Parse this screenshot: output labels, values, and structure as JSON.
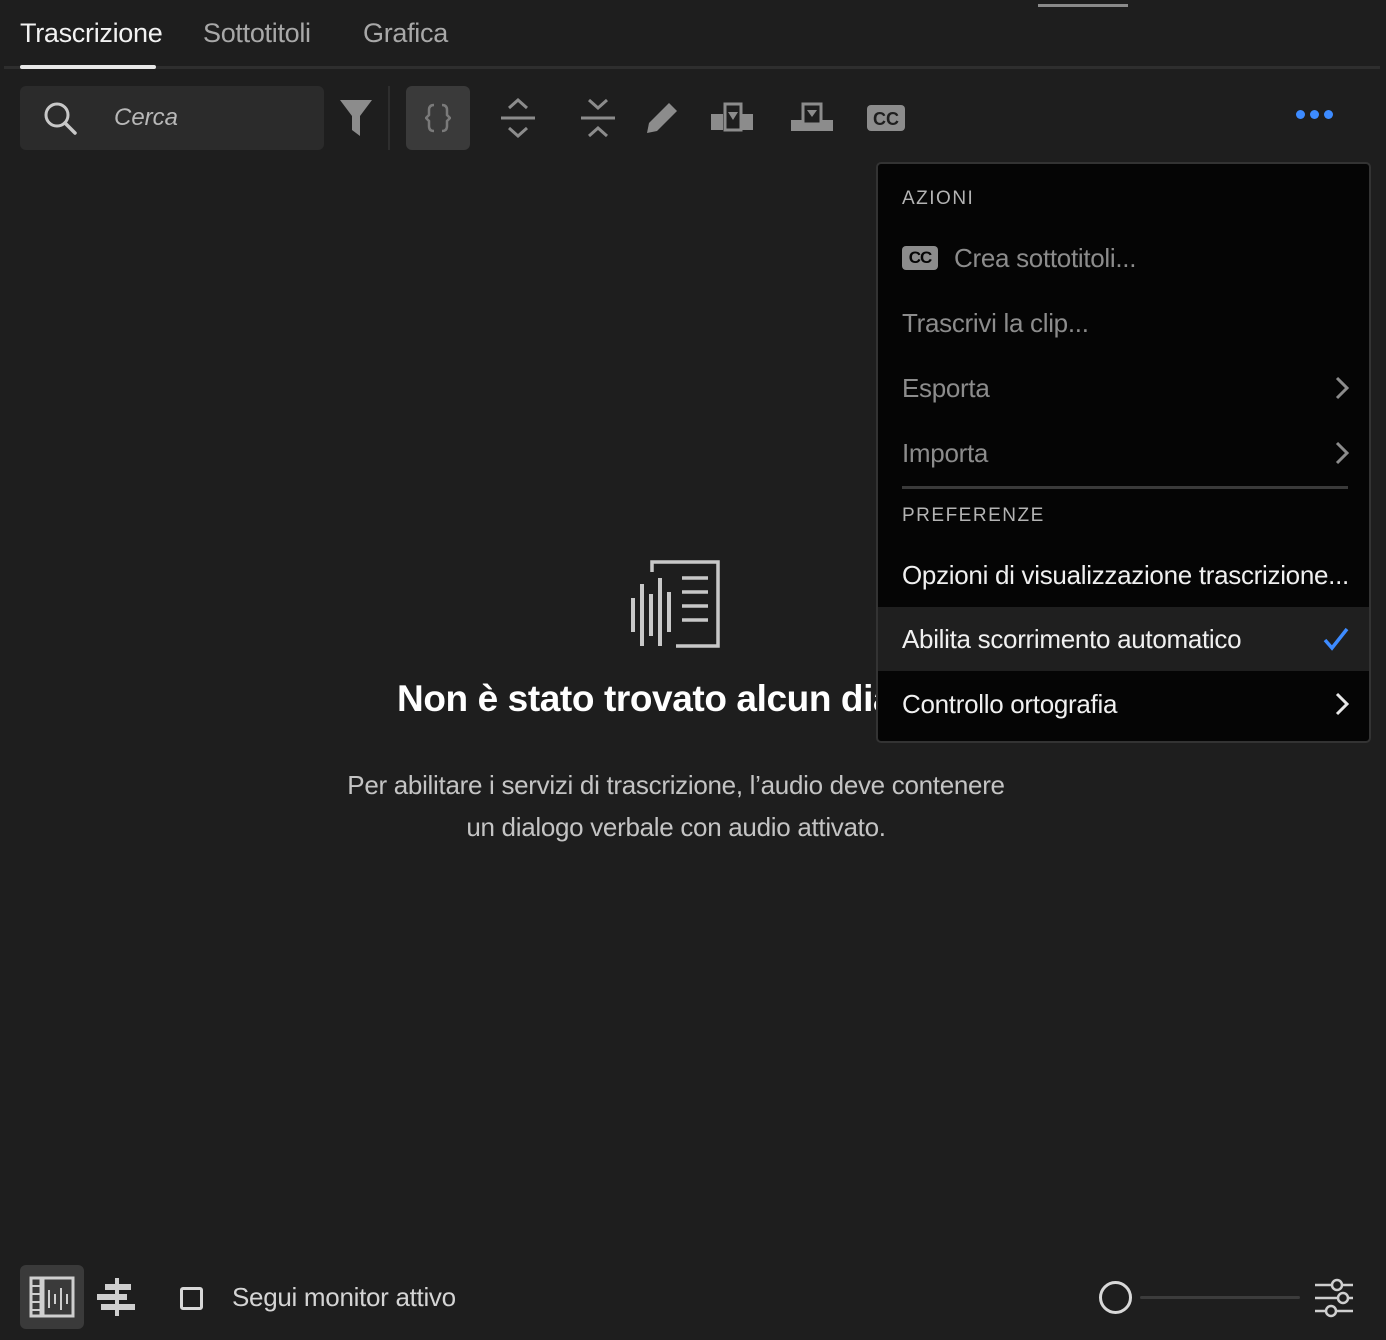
{
  "tabs": [
    {
      "label": "Trascrizione",
      "active": true
    },
    {
      "label": "Sottotitoli",
      "active": false
    },
    {
      "label": "Grafica",
      "active": false
    }
  ],
  "toolbar": {
    "search_placeholder": "Cerca",
    "icons": [
      "search-icon",
      "filter-icon",
      "merge-segments-icon",
      "expand-icon",
      "collapse-icon",
      "pencil-icon",
      "insert-icon",
      "overwrite-icon",
      "cc-icon",
      "more-icon"
    ],
    "cc_label": "CC",
    "accent_color": "#3d8bff"
  },
  "empty_state": {
    "title": "Non è stato trovato alcun dia",
    "description_line1": "Per abilitare i servizi di trascrizione, l’audio deve contenere",
    "description_line2": "un dialogo verbale con audio attivato."
  },
  "menu": {
    "section_actions": "AZIONI",
    "create_captions": "Crea sottotitoli...",
    "cc_badge": "CC",
    "transcribe_clip": "Trascrivi la clip...",
    "export": "Esporta",
    "import": "Importa",
    "section_preferences": "PREFERENZE",
    "display_options": "Opzioni di visualizzazione trascrizione...",
    "auto_scroll": "Abilita scorrimento automatico",
    "auto_scroll_checked": true,
    "spell_check": "Controllo ortografia"
  },
  "bottom_bar": {
    "follow_monitor_label": "Segui monitor attivo",
    "follow_monitor_checked": false,
    "zoom_level": 0
  }
}
